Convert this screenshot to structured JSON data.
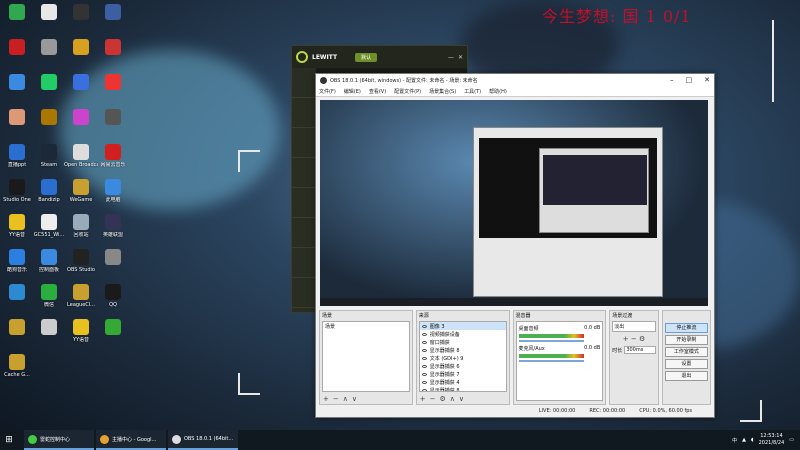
{
  "overlay": {
    "title": "今生梦想: 国 1 0/1"
  },
  "desktop_icons": [
    {
      "label": "",
      "color": "#2fa84f"
    },
    {
      "label": "",
      "color": "#e8e8e8"
    },
    {
      "label": "",
      "color": "#333"
    },
    {
      "label": "",
      "color": "#3b5fa0"
    },
    {
      "label": "",
      "color": "#c82020"
    },
    {
      "label": "",
      "color": "#999"
    },
    {
      "label": "",
      "color": "#d8a020"
    },
    {
      "label": "",
      "color": "#c33"
    },
    {
      "label": "",
      "color": "#3a8ae0"
    },
    {
      "label": "",
      "color": "#2c6"
    },
    {
      "label": "",
      "color": "#3a6fe0"
    },
    {
      "label": "",
      "color": "#e33"
    },
    {
      "label": "",
      "color": "#d97"
    },
    {
      "label": "",
      "color": "#a70"
    },
    {
      "label": "",
      "color": "#c4c"
    },
    {
      "label": "",
      "color": "#555"
    },
    {
      "label": "直播ppt",
      "color": "#2a6fd0"
    },
    {
      "label": "Steam",
      "color": "#1b2838"
    },
    {
      "label": "Open Broadcast...",
      "color": "#ddd"
    },
    {
      "label": "网易云音乐",
      "color": "#d02020"
    },
    {
      "label": "Studio One",
      "color": "#1a1a1a"
    },
    {
      "label": "Bandizip",
      "color": "#2a6fd0"
    },
    {
      "label": "WeGame",
      "color": "#c8a030"
    },
    {
      "label": "此电脑",
      "color": "#3a8ae0"
    },
    {
      "label": "YY语音",
      "color": "#e8c020"
    },
    {
      "label": "GC551_Wi...",
      "color": "#eee"
    },
    {
      "label": "回收站",
      "color": "#9ab"
    },
    {
      "label": "英雄联盟",
      "color": "#335"
    },
    {
      "label": "酷狗音乐",
      "color": "#2a7fe0"
    },
    {
      "label": "控制面板",
      "color": "#3a8ae0"
    },
    {
      "label": "OBS Studio",
      "color": "#222"
    },
    {
      "label": "",
      "color": "#888"
    },
    {
      "label": "",
      "color": "#2c8ad0"
    },
    {
      "label": "微信",
      "color": "#2aae40"
    },
    {
      "label": "LeagueCl...",
      "color": "#c8a030"
    },
    {
      "label": "QQ",
      "color": "#1a1a1a"
    },
    {
      "label": "",
      "color": "#c8a030"
    },
    {
      "label": "",
      "color": "#ccc"
    },
    {
      "label": "YY语音",
      "color": "#e8c020"
    },
    {
      "label": "",
      "color": "#3a3"
    },
    {
      "label": "Cache G...",
      "color": "#c8a030"
    }
  ],
  "lewitt": {
    "brand": "LEWITT",
    "mode": "默认",
    "sidebar": [
      "",
      "",
      "",
      "",
      "",
      "",
      "",
      ""
    ]
  },
  "obs": {
    "title": "OBS 18.0.1 (64bit, windows) - 配置文件: 未命名 - 场景: 未命名",
    "menu": [
      "文件(F)",
      "编辑(E)",
      "查看(V)",
      "配置文件(P)",
      "场景集合(S)",
      "工具(T)",
      "帮助(H)"
    ],
    "docks": {
      "scenes": {
        "title": "场景",
        "items": [
          "场景"
        ]
      },
      "sources": {
        "title": "来源",
        "items": [
          "图像 3",
          "视频捕获设备",
          "窗口捕获",
          "显示器捕获 8",
          "文本 (GDI+) 9",
          "显示器捕获 6",
          "显示器捕获 7",
          "显示器捕获 4",
          "显示器捕获 8"
        ]
      },
      "mixer": {
        "title": "混音器",
        "tracks": [
          {
            "name": "桌面音频",
            "db": "0.0 dB"
          },
          {
            "name": "麦克风/Aux",
            "db": "0.0 dB"
          }
        ]
      },
      "transitions": {
        "title": "场景过渡",
        "type": "淡出",
        "duration_label": "时长",
        "duration": "300ms"
      },
      "controls": [
        "停止推流",
        "开始录制",
        "工作室模式",
        "设置",
        "退出"
      ]
    },
    "status": {
      "live": "LIVE: 00:00:00",
      "rec": "REC: 00:00:00",
      "cpu": "CPU: 0.0%, 60.00 fps"
    }
  },
  "taskbar": {
    "items": [
      {
        "label": "雷蛇控制中心",
        "color": "#44cc44"
      },
      {
        "label": "主播中心 - Googl...",
        "color": "#e8a030"
      },
      {
        "label": "OBS 18.0.1 (64bit...",
        "color": "#ddd"
      }
    ],
    "tray_lang": "中",
    "time": "12:53:14",
    "date": "2021/8/24"
  }
}
